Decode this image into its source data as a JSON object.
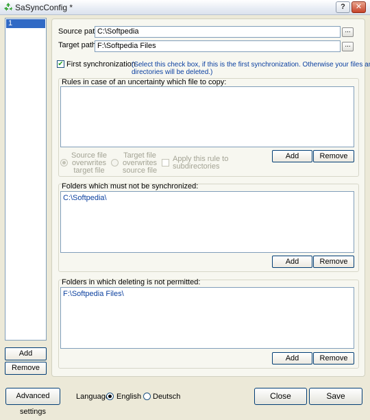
{
  "window": {
    "title": "SaSyncConfig *",
    "help_glyph": "?",
    "close_glyph": "✕"
  },
  "sidebar": {
    "items": [
      "1"
    ],
    "add_label": "Add",
    "remove_label": "Remove"
  },
  "paths": {
    "source_label": "Source path:",
    "source_value": "C:\\Softpedia",
    "target_label": "Target path:",
    "target_value": "F:\\Softpedia Files",
    "browse_label": "..."
  },
  "first_sync": {
    "label": "First synchronization",
    "checked": true,
    "hint_line1": "(Select this check box, if this is the first synchronization. Otherwise your files and",
    "hint_line2": "directories will be deleted.)"
  },
  "rules": {
    "title": "Rules in case of an uncertainty which file to copy:",
    "option_source": [
      "Source file",
      "overwrites",
      "target file"
    ],
    "option_target": [
      "Target file",
      "overwrites",
      "source file"
    ],
    "apply_sub": [
      "Apply this rule to",
      "subdirectories"
    ],
    "add_label": "Add",
    "remove_label": "Remove"
  },
  "no_sync": {
    "title": "Folders which must not be synchronized:",
    "entries": [
      "C:\\Softpedia\\"
    ],
    "add_label": "Add",
    "remove_label": "Remove"
  },
  "no_delete": {
    "title": "Folders in which deleting is not permitted:",
    "entries": [
      "F:\\Softpedia Files\\"
    ],
    "add_label": "Add",
    "remove_label": "Remove"
  },
  "footer": {
    "advanced_label": "Advanced settings",
    "language_label": "Language:",
    "lang_english": "English",
    "lang_deutsch": "Deutsch",
    "selected_language": "English",
    "close_label": "Close",
    "save_label": "Save"
  }
}
